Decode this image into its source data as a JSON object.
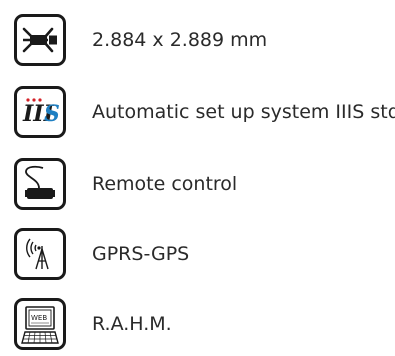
{
  "features": [
    {
      "label": "2.884 x 2.889 mm",
      "icon": "scanner-dimension-icon"
    },
    {
      "label": "Automatic set up system IIIS std.",
      "icon": "iiis-logo-icon",
      "icon_text_main": "III",
      "icon_text_accent": "S"
    },
    {
      "label": "Remote control",
      "icon": "remote-control-icon"
    },
    {
      "label": "GPRS-GPS",
      "icon": "antenna-signal-icon"
    },
    {
      "label": "R.A.H.M.",
      "icon": "web-computer-icon",
      "icon_text": "WEB"
    }
  ],
  "colors": {
    "icon_stroke": "#1a1a1a",
    "text": "#2a2a2a",
    "iis_red": "#d42027",
    "iis_blue": "#1e7fc2"
  }
}
